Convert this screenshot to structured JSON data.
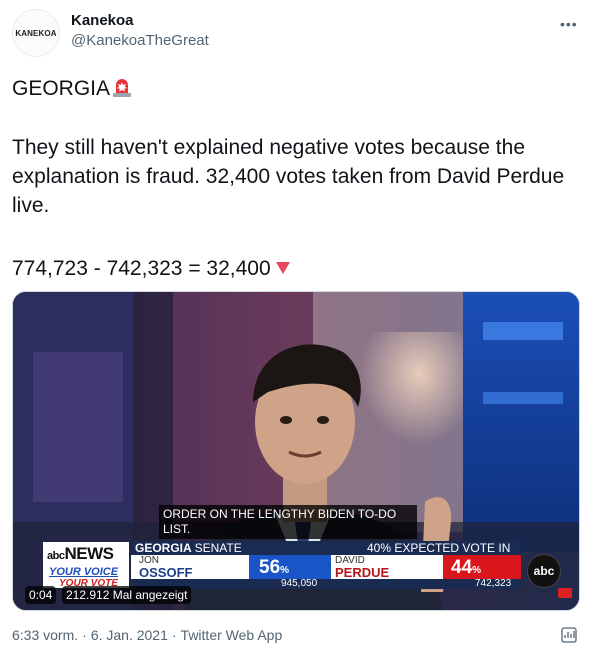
{
  "author": {
    "avatar_text": "KANEKOA",
    "display_name": "Kanekoa",
    "handle": "@KanekoaTheGreat"
  },
  "more_icon": "ellipsis-icon",
  "tweet": {
    "line1": "GEORGIA",
    "line1_emoji": "police-light-emoji",
    "paragraph2": "They still haven't explained negative votes because the explanation is fraud. 32,400 votes taken from David Perdue live.",
    "line3": "774,723 - 742,323 = 32,400",
    "line3_emoji": "red-triangle-down-emoji"
  },
  "video": {
    "caption": "ORDER ON THE LENGTHY BIDEN TO-DO LIST.",
    "network": "NEWS",
    "network_prefix": "abc",
    "slogan_line1": "YOUR VOICE",
    "slogan_line2": "YOUR VOTE",
    "race_title_bold": "GEORGIA",
    "race_title_light": "SENATE",
    "expected": "40% EXPECTED VOTE IN",
    "left_candidate": {
      "first": "JON",
      "last": "OSSOFF",
      "pct": "56",
      "pct_sign": "%",
      "votes": "945,050",
      "color": "#1a55c8"
    },
    "right_candidate": {
      "first": "DAVID",
      "last": "PERDUE",
      "pct": "44",
      "pct_sign": "%",
      "votes": "742,323",
      "color": "#d8161c"
    },
    "abc_logo": "abc",
    "elapsed": "0:04",
    "views": "212.912 Mal angezeigt"
  },
  "footer": {
    "time": "6:33 vorm.",
    "date": "6. Jan. 2021",
    "source": "Twitter Web App",
    "sep": "·",
    "analytics_icon": "analytics-icon"
  }
}
